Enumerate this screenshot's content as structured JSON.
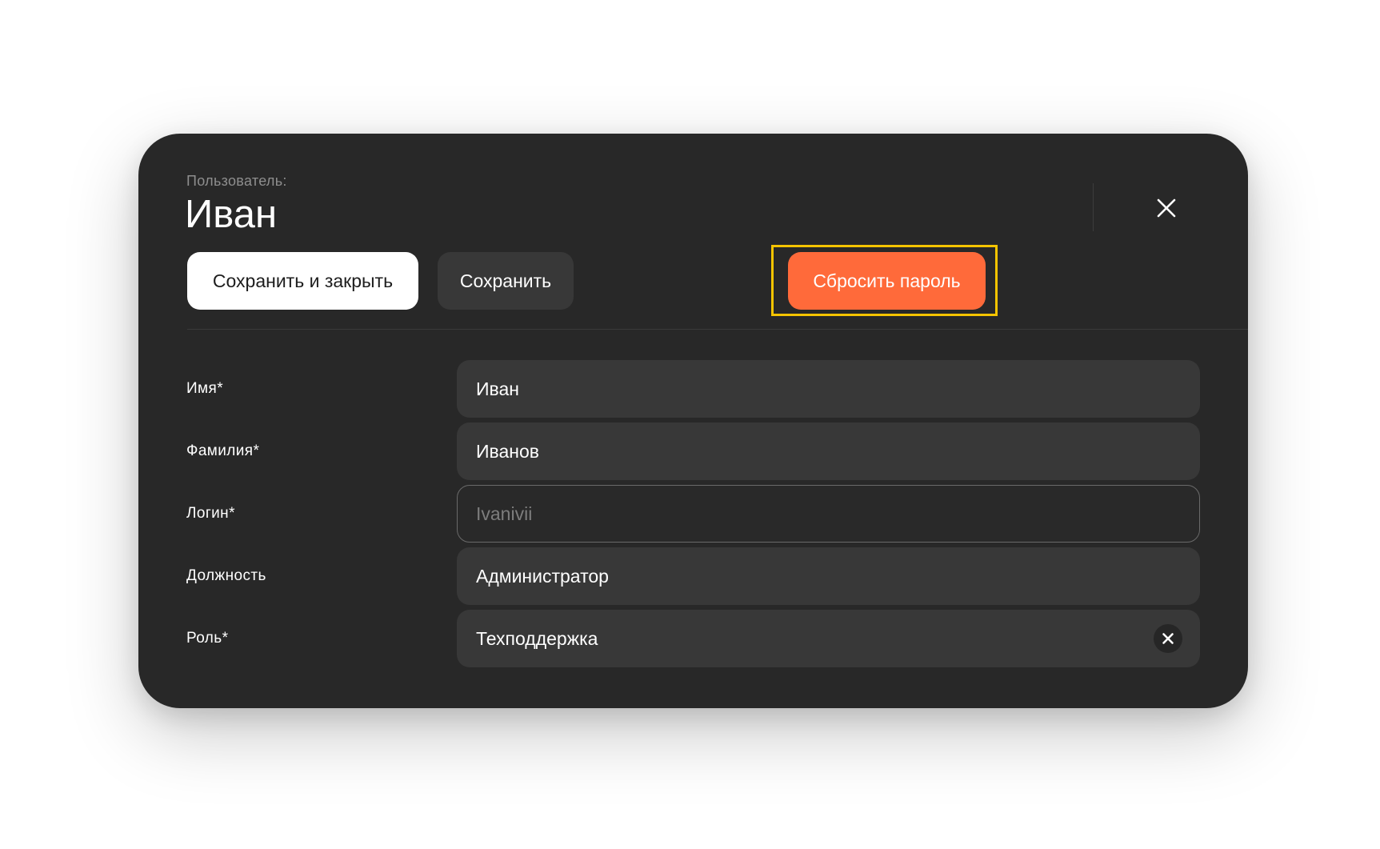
{
  "header": {
    "subtitle": "Пользователь:",
    "title": "Иван"
  },
  "toolbar": {
    "save_close_label": "Сохранить и закрыть",
    "save_label": "Сохранить",
    "reset_password_label": "Сбросить пароль"
  },
  "colors": {
    "modal_bg": "#282828",
    "accent": "#ff6a3a",
    "highlight": "#f5c400",
    "field_bg": "#383838"
  },
  "form": {
    "first_name": {
      "label": "Имя*",
      "value": "Иван"
    },
    "last_name": {
      "label": "Фамилия*",
      "value": "Иванов"
    },
    "login": {
      "label": "Логин*",
      "placeholder": "Ivanivii"
    },
    "position": {
      "label": "Должность",
      "value": "Администратор"
    },
    "role": {
      "label": "Роль*",
      "value": "Техподдержка"
    }
  },
  "icons": {
    "close": "close-icon",
    "clear": "clear-icon"
  }
}
